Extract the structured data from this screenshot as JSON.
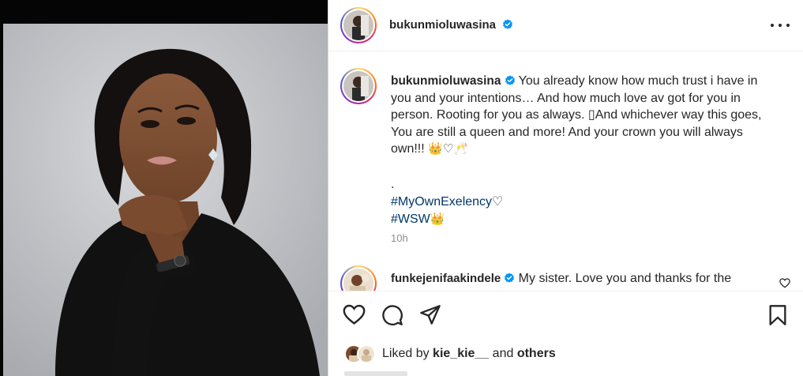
{
  "post": {
    "author": "bukunmioluwasina",
    "verified": true
  },
  "caption": {
    "author": "bukunmioluwasina",
    "text": " You already know how much trust i have in you and your intentions… And how much love av got for you in person. Rooting for you as always. ▯And whichever way this goes, You are still a queen and more! And your crown you will always own!!! ",
    "emojis": "👑♡🥂",
    "dot": ".",
    "tag1": "#MyOwnExelency",
    "tag1_emoji": "♡",
    "tag2": "#WSW",
    "tag2_emoji": "👑",
    "time": "10h"
  },
  "comment": {
    "author": "funkejenifaakindele",
    "text": " My sister. Love you and thanks for the"
  },
  "likes": {
    "prefix": "Liked by ",
    "user": "kie_kie__",
    "middle": " and ",
    "others": "others"
  },
  "icons": {
    "like": "heart-icon",
    "comment": "comment-icon",
    "share": "send-icon",
    "save": "bookmark-icon",
    "more": "more-icon",
    "verified": "verified-badge-icon"
  },
  "colors": {
    "verified_blue": "#0095f6",
    "link": "#00376b",
    "muted": "#8e8e8e"
  }
}
